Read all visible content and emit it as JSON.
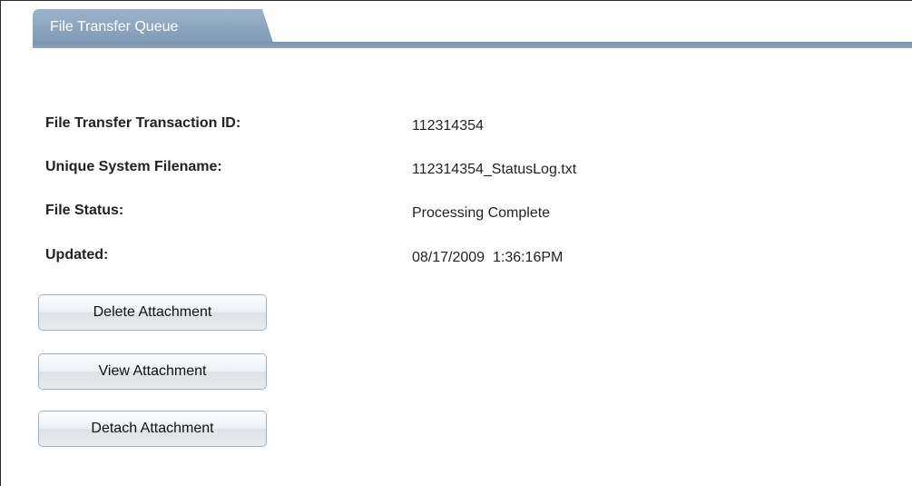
{
  "tab": {
    "label": "File Transfer Queue"
  },
  "fields": [
    {
      "label": "File Transfer Transaction ID:",
      "value": "112314354"
    },
    {
      "label": "Unique System Filename:",
      "value": "112314354_StatusLog.txt"
    },
    {
      "label": "File Status:",
      "value": "Processing Complete"
    },
    {
      "label": "Updated:",
      "value": "08/17/2009  1:36:16PM"
    }
  ],
  "buttons": {
    "delete": "Delete Attachment",
    "view": "View Attachment",
    "detach": "Detach Attachment"
  },
  "colors": {
    "tab_background": "#8aa3bd",
    "tab_text": "#ffffff",
    "label_text": "#222222",
    "button_border": "#a8b2bd"
  }
}
